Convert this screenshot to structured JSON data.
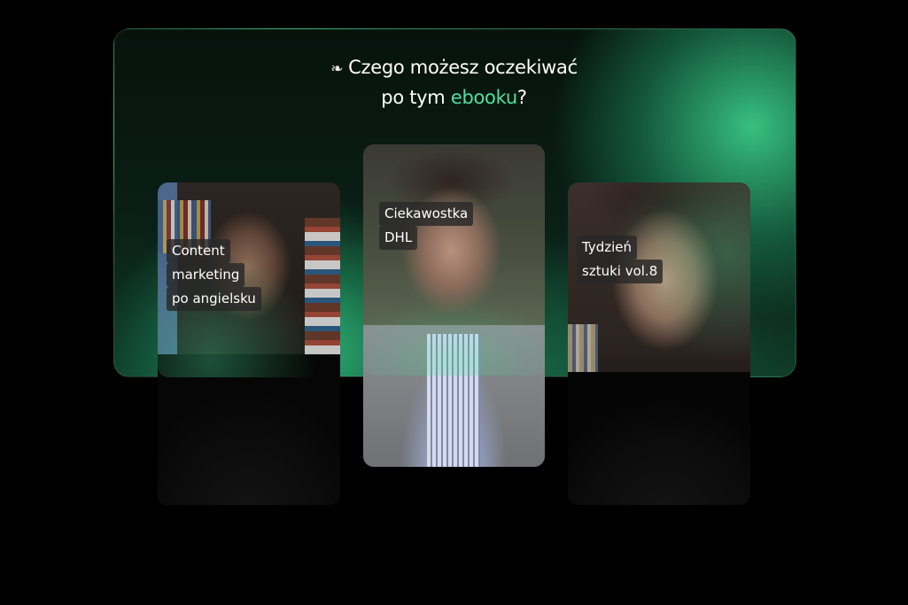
{
  "header": {
    "ornament": "❧",
    "line1": "Czego możesz oczekiwać",
    "line2_prefix": "po tym ",
    "line2_accent": "ebooku",
    "line2_suffix": "?"
  },
  "colors": {
    "background": "#000000",
    "accent": "#4fe0a0",
    "panel_glow": "#37cd87"
  },
  "cards": [
    {
      "caption_lines": [
        "Content",
        "marketing",
        "po angielsku"
      ]
    },
    {
      "caption_lines": [
        "Ciekawostka",
        "DHL"
      ]
    },
    {
      "caption_lines": [
        "Tydzień",
        "sztuki vol.8"
      ]
    }
  ]
}
